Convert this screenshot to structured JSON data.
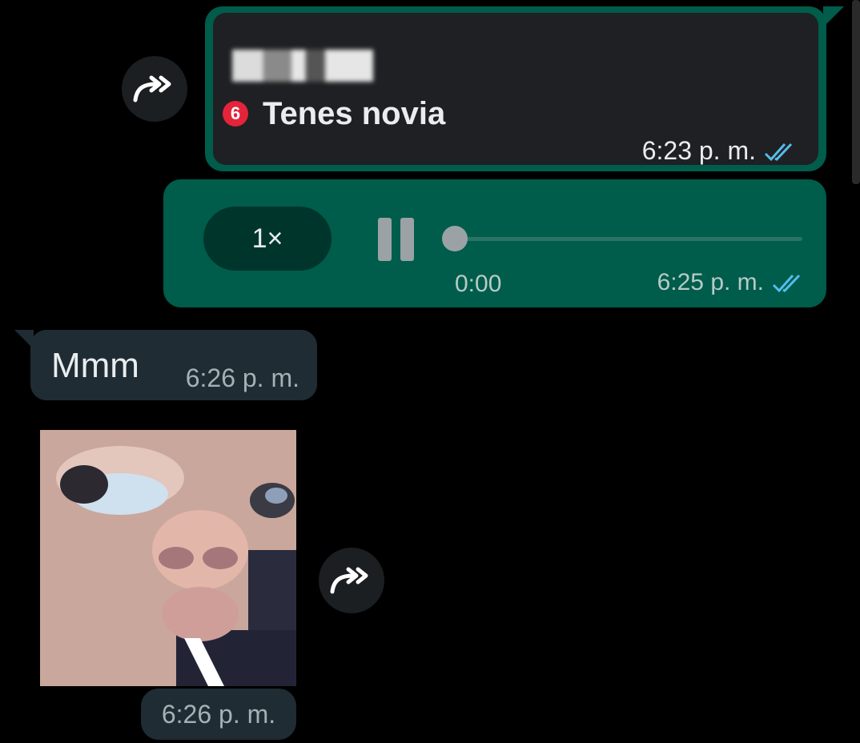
{
  "messages": {
    "status_reply": {
      "quoted_name": "",
      "status_count": "6",
      "quoted_text": "Tenes novia",
      "time": "6:23 p. m."
    },
    "voice_note": {
      "speed": "1×",
      "duration": "0:00",
      "time": "6:25 p. m."
    },
    "incoming_text": {
      "text": "Mmm",
      "time": "6:26 p. m."
    },
    "sticker": {
      "time": "6:26 p. m."
    }
  },
  "colors": {
    "outgoing_bubble": "#005c4b",
    "incoming_bubble": "#1f2c33",
    "read_ticks": "#53bdeb",
    "status_badge": "#e3243b"
  },
  "icons": [
    "forward-icon",
    "double-check-icon",
    "pause-icon"
  ]
}
